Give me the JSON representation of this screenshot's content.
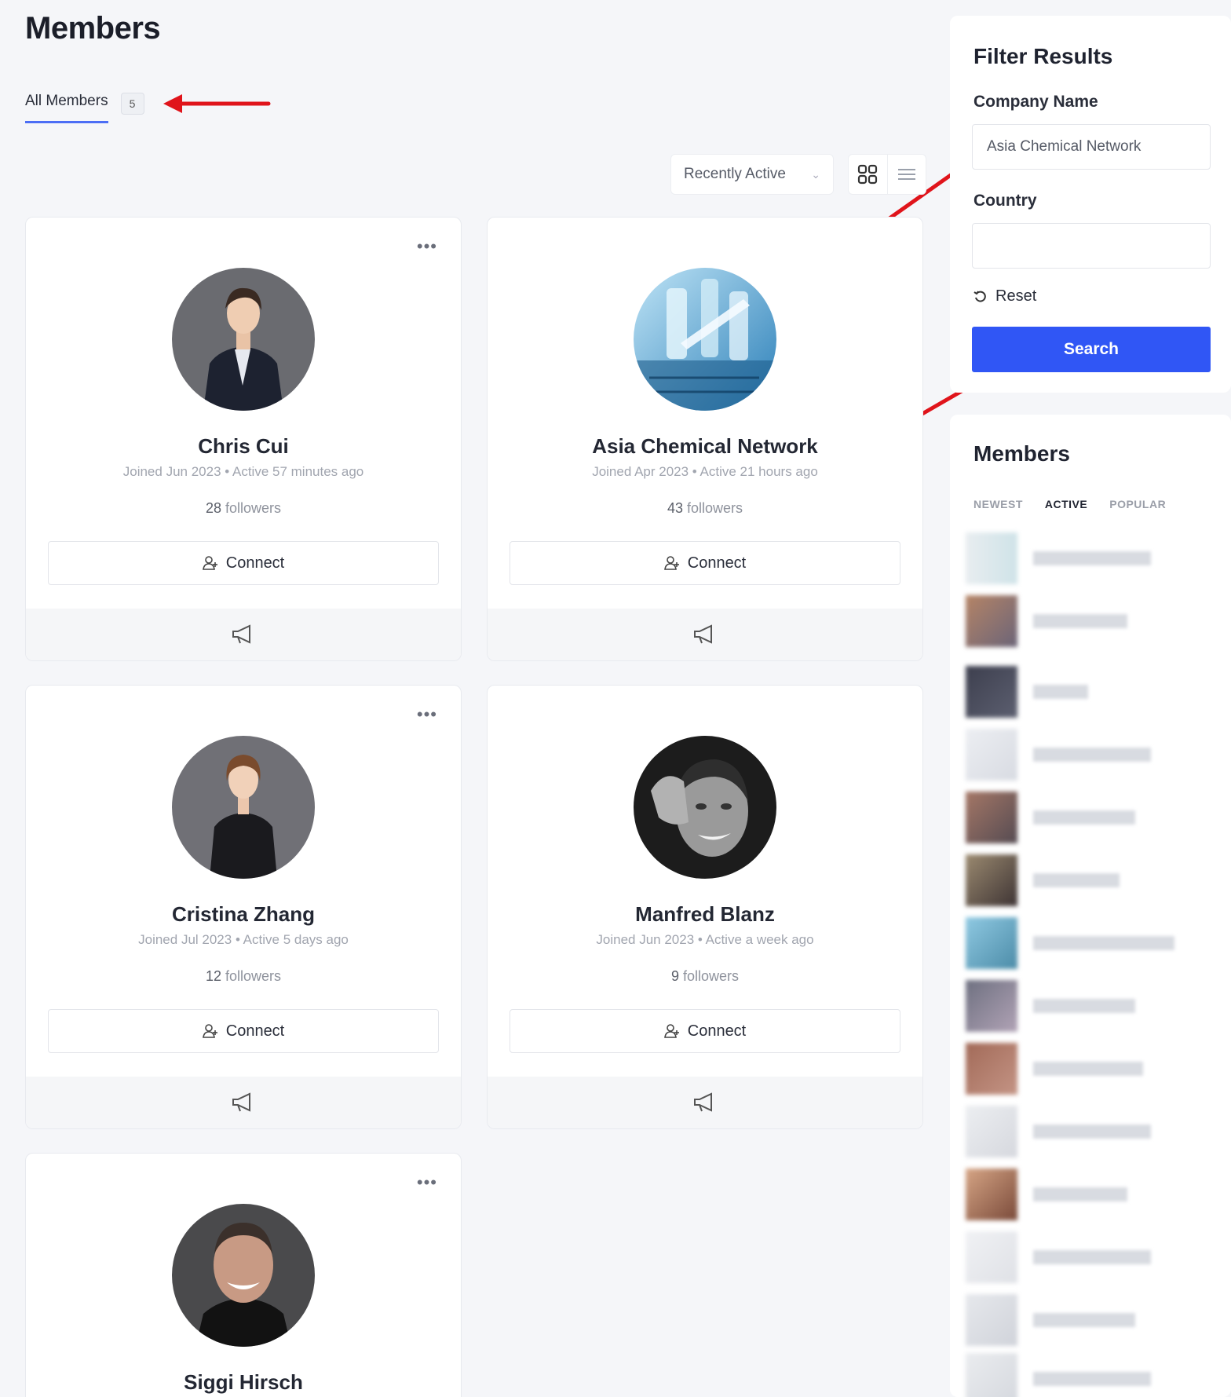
{
  "page": {
    "title": "Members"
  },
  "tabs": {
    "all_members_label": "All Members",
    "all_members_count": "5"
  },
  "toolbar": {
    "sort_value": "Recently Active"
  },
  "members": [
    {
      "name": "Chris Cui",
      "meta": "Joined Jun 2023 • Active 57 minutes ago",
      "followers_count": "28",
      "followers_label": "followers",
      "connect_label": "Connect"
    },
    {
      "name": "Asia Chemical Network",
      "meta": "Joined Apr 2023 • Active 21 hours ago",
      "followers_count": "43",
      "followers_label": "followers",
      "connect_label": "Connect"
    },
    {
      "name": "Cristina Zhang",
      "meta": "Joined Jul 2023 • Active 5 days ago",
      "followers_count": "12",
      "followers_label": "followers",
      "connect_label": "Connect"
    },
    {
      "name": "Manfred Blanz",
      "meta": "Joined Jun 2023 • Active a week ago",
      "followers_count": "9",
      "followers_label": "followers",
      "connect_label": "Connect"
    },
    {
      "name": "Siggi Hirsch"
    }
  ],
  "filter": {
    "title": "Filter Results",
    "company_label": "Company Name",
    "company_value": "Asia Chemical Network",
    "country_label": "Country",
    "country_value": "",
    "reset_label": "Reset",
    "search_label": "Search"
  },
  "members_widget": {
    "title": "Members",
    "tabs": [
      "NEWEST",
      "ACTIVE",
      "POPULAR"
    ],
    "active_tab": "ACTIVE"
  },
  "colors": {
    "accent": "#3056f5",
    "tab_underline": "#4c6ef5",
    "annotation_arrow": "#e0141b"
  }
}
